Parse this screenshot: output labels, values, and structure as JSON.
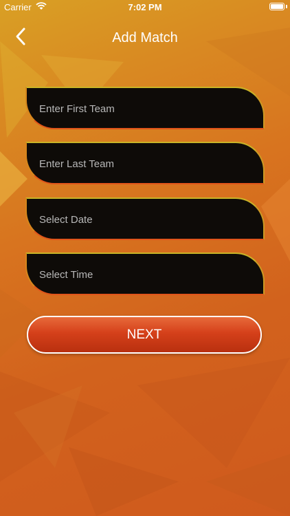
{
  "status_bar": {
    "carrier": "Carrier",
    "time": "7:02 PM"
  },
  "nav": {
    "title": "Add Match",
    "back_icon": "chevron-left-icon"
  },
  "form": {
    "first_team": {
      "placeholder": "Enter First Team",
      "value": ""
    },
    "last_team": {
      "placeholder": "Enter Last Team",
      "value": ""
    },
    "date": {
      "placeholder": "Select Date",
      "value": ""
    },
    "time": {
      "placeholder": "Select Time",
      "value": ""
    }
  },
  "next_label": "NEXT",
  "colors": {
    "field_background": "#0e0b08",
    "button_red": "#d5401a",
    "background_orange": "#d8741f"
  }
}
